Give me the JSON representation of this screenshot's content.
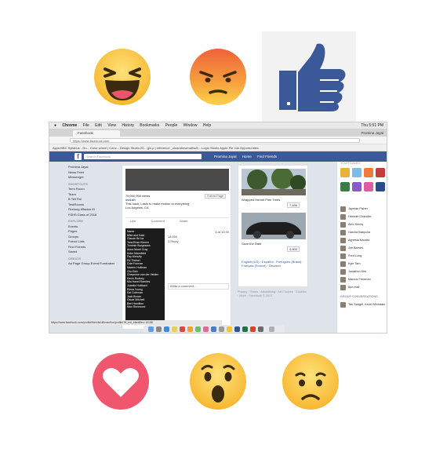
{
  "reactions": {
    "top": [
      "haha-emoji-icon",
      "angry-emoji-icon",
      "like-thumb-icon"
    ],
    "bottom": [
      "love-heart-icon",
      "wow-emoji-icon",
      "sad-emoji-icon"
    ]
  },
  "mac_menu": {
    "app": "Chrome",
    "items": [
      "File",
      "Edit",
      "View",
      "History",
      "Bookmarks",
      "People",
      "Window",
      "Help"
    ],
    "clock": "Thu 5:51 PM"
  },
  "browser": {
    "tab_title": "Facebook",
    "url": "https://www.facebook.com",
    "bookmarks": "Apps  BBC Syllabus - Gu...  Color wheel | Canv...  Design Studio 20...  g/x.p | reference  _uk/andrewmaths/6...  Login Studio  Apple Pie  Job Opportunities"
  },
  "facebook": {
    "logo": "f",
    "search_placeholder": "Search Facebook",
    "nav": [
      "Home",
      "Find Friends"
    ],
    "left_nav": {
      "profile": "Promina Jayal",
      "items": [
        "News Feed",
        "Messenger"
      ],
      "shortcuts_header": "SHORTCUTS",
      "shortcuts": [
        "Term Room",
        "Team",
        "B Tell Pal",
        "TestRooms",
        "Firelong Mission ID",
        "FSHS Class of 2018"
      ],
      "explore_header": "EXPLORE",
      "explore": [
        "Events",
        "Pages",
        "Groups",
        "Friend Lists",
        "Find Friends",
        "Saved"
      ],
      "create_header": "CREATE",
      "create": "Ad  Page  Group  Event  Fundraiser"
    },
    "post": {
      "views": "75,000,000 views",
      "author": "ssd.ah",
      "caption": "This hack, Lasts to make motion to everything",
      "location": "Los Angeles, CA",
      "follow": "Follow Page",
      "actions": [
        "Like",
        "Comment",
        "Share"
      ],
      "timestamp": "4 at 10:30",
      "comments": [
        "18,000",
        "3 Reply",
        "Write a comment..."
      ]
    },
    "reaction_menu": [
      "Name",
      "Mike and Kate",
      "Claude Bri ha",
      "Tara-Rose Klemm",
      "Tommie Burgesses",
      "Anna Murel Cray",
      "Kobe Mansfield",
      "Fay Mcnulty",
      "Ed Thelsel",
      "Cole Forman",
      "Naeem Hollman",
      "Cho Boh",
      "Cheyenne van der Velden",
      "Kevin Rodney",
      "Mia Hazel Ramirez",
      "Juanita Hubbard",
      "Elena Young",
      "Kai Coleman",
      "Jack Brown",
      "Oscar Mitchell",
      "Bert Hamilton",
      "Max Richmond"
    ],
    "sponsored": [
      {
        "title": "Wrapped Hermit Pine Trees",
        "price": "7,496"
      },
      {
        "title": "Save the Date",
        "price": "4,500"
      }
    ],
    "footer": "Privacy · Terms · Advertising · Ad Choices · Cookies · More · Facebook © 2017",
    "languages": "English (US) · Español · Português (Brasil) · Français (France) · Deutsch",
    "right_header": "YOUR GAMES",
    "contacts": [
      "Jayman Fisher",
      "Hannah Chandler",
      "Alex Kenny",
      "Harcha Babycha",
      "Agnesia Nandra",
      "Jim Barnes",
      "Fred Long",
      "Kyle Tam",
      "Jonathon Kim",
      "Marcus Freeman",
      "Ben Hall"
    ],
    "group_header": "GROUP CONVERSATIONS",
    "group_item": "Tan Sangel, Kevin Minhaam"
  },
  "status_url": "https://www.facebook.com/profile/friends/ufi/reaction/profile/?ft_ent_identifier=10158"
}
